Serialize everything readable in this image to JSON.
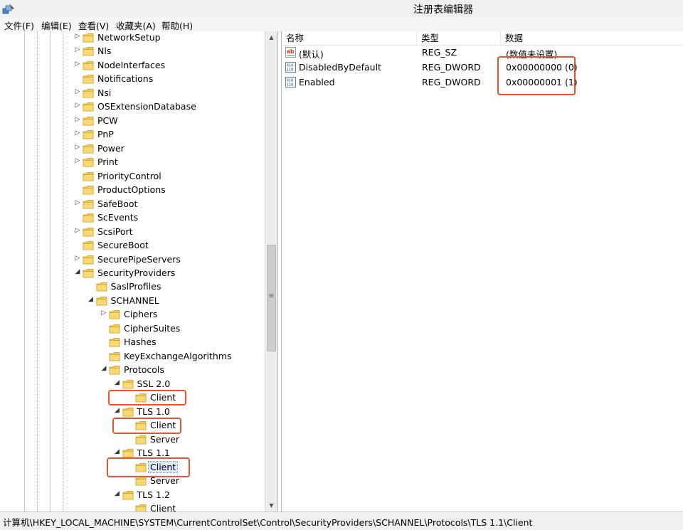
{
  "window": {
    "title": "注册表编辑器",
    "icon": "regedit-icon"
  },
  "menu": [
    "文件(F)",
    "编辑(E)",
    "查看(V)",
    "收藏夹(A)",
    "帮助(H)"
  ],
  "tree": {
    "items": [
      {
        "label": "NetworkSetup",
        "depth": 0,
        "expander": "▷"
      },
      {
        "label": "Nls",
        "depth": 0,
        "expander": "▷"
      },
      {
        "label": "NodeInterfaces",
        "depth": 0,
        "expander": "▷"
      },
      {
        "label": "Notifications",
        "depth": 0,
        "expander": ""
      },
      {
        "label": "Nsi",
        "depth": 0,
        "expander": "▷"
      },
      {
        "label": "OSExtensionDatabase",
        "depth": 0,
        "expander": "▷"
      },
      {
        "label": "PCW",
        "depth": 0,
        "expander": "▷"
      },
      {
        "label": "PnP",
        "depth": 0,
        "expander": "▷"
      },
      {
        "label": "Power",
        "depth": 0,
        "expander": "▷"
      },
      {
        "label": "Print",
        "depth": 0,
        "expander": "▷"
      },
      {
        "label": "PriorityControl",
        "depth": 0,
        "expander": ""
      },
      {
        "label": "ProductOptions",
        "depth": 0,
        "expander": ""
      },
      {
        "label": "SafeBoot",
        "depth": 0,
        "expander": "▷"
      },
      {
        "label": "ScEvents",
        "depth": 0,
        "expander": ""
      },
      {
        "label": "ScsiPort",
        "depth": 0,
        "expander": "▷"
      },
      {
        "label": "SecureBoot",
        "depth": 0,
        "expander": ""
      },
      {
        "label": "SecurePipeServers",
        "depth": 0,
        "expander": "▷"
      },
      {
        "label": "SecurityProviders",
        "depth": 0,
        "expander": "◢"
      },
      {
        "label": "SaslProfiles",
        "depth": 1,
        "expander": ""
      },
      {
        "label": "SCHANNEL",
        "depth": 1,
        "expander": "◢"
      },
      {
        "label": "Ciphers",
        "depth": 2,
        "expander": "▷"
      },
      {
        "label": "CipherSuites",
        "depth": 2,
        "expander": ""
      },
      {
        "label": "Hashes",
        "depth": 2,
        "expander": ""
      },
      {
        "label": "KeyExchangeAlgorithms",
        "depth": 2,
        "expander": ""
      },
      {
        "label": "Protocols",
        "depth": 2,
        "expander": "◢"
      },
      {
        "label": "SSL 2.0",
        "depth": 3,
        "expander": "◢"
      },
      {
        "label": "Client",
        "depth": 4,
        "expander": ""
      },
      {
        "label": "TLS 1.0",
        "depth": 3,
        "expander": "◢"
      },
      {
        "label": "Client",
        "depth": 4,
        "expander": ""
      },
      {
        "label": "Server",
        "depth": 4,
        "expander": ""
      },
      {
        "label": "TLS 1.1",
        "depth": 3,
        "expander": "◢"
      },
      {
        "label": "Client",
        "depth": 4,
        "expander": "",
        "selected": true
      },
      {
        "label": "Server",
        "depth": 4,
        "expander": ""
      },
      {
        "label": "TLS 1.2",
        "depth": 3,
        "expander": "◢"
      },
      {
        "label": "Client",
        "depth": 4,
        "expander": ""
      }
    ]
  },
  "values": {
    "headers": {
      "name": "名称",
      "type": "类型",
      "data": "数据"
    },
    "rows": [
      {
        "icon": "string-value-icon",
        "name": "(默认)",
        "type": "REG_SZ",
        "data": "(数值未设置)"
      },
      {
        "icon": "binary-value-icon",
        "name": "DisabledByDefault",
        "type": "REG_DWORD",
        "data": "0x00000000 (0)"
      },
      {
        "icon": "binary-value-icon",
        "name": "Enabled",
        "type": "REG_DWORD",
        "data": "0x00000001 (1)"
      }
    ]
  },
  "status": {
    "path": "计算机\\HKEY_LOCAL_MACHINE\\SYSTEM\\CurrentControlSet\\Control\\SecurityProviders\\SCHANNEL\\Protocols\\TLS 1.1\\Client"
  },
  "colors": {
    "highlight": "#e8542b",
    "folder": "#f3c94f",
    "selection": "#dbeaf9"
  }
}
